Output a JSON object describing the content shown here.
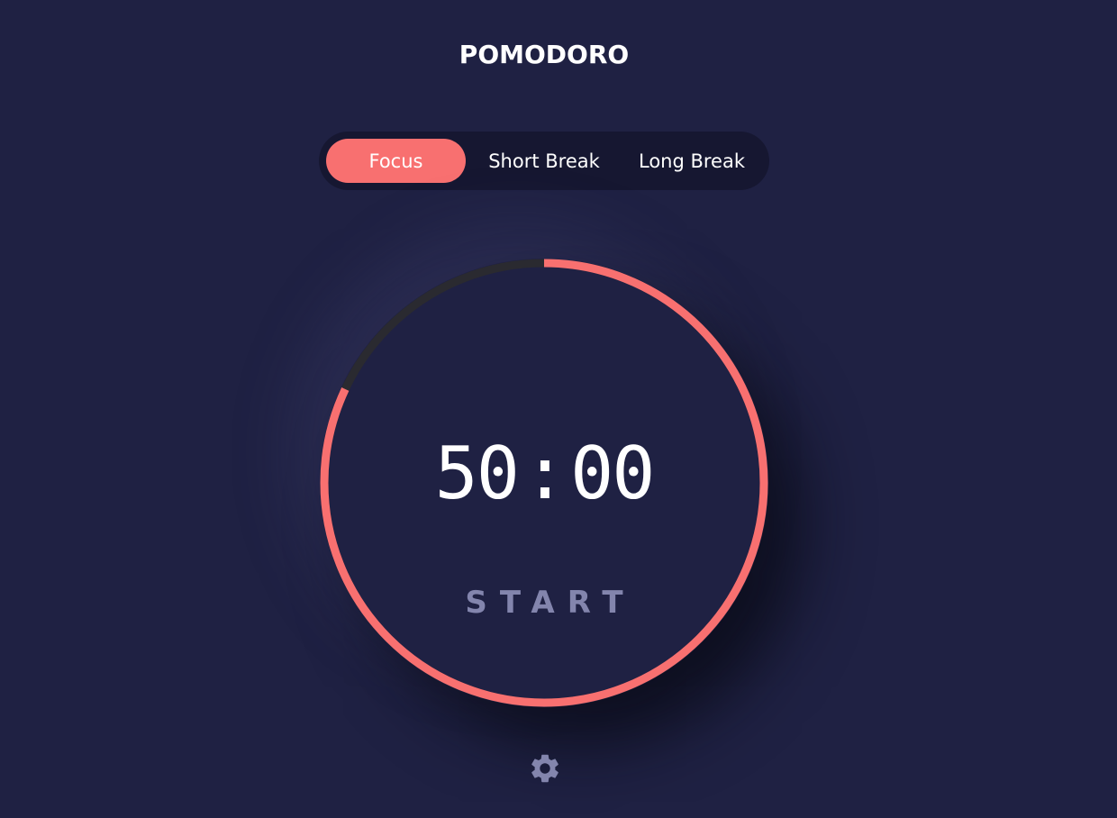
{
  "app": {
    "title": "POMODORO"
  },
  "modes": [
    {
      "label": "Focus",
      "active": true
    },
    {
      "label": "Short Break",
      "active": false
    },
    {
      "label": "Long Break",
      "active": false
    }
  ],
  "timer": {
    "minutes": "50",
    "separator": ":",
    "seconds": "00",
    "action_label": "START",
    "progress": 0.82
  },
  "icons": {
    "settings": "gear-icon"
  },
  "colors": {
    "background": "#1f2143",
    "accent": "#f87070",
    "track": "#2a2a30",
    "muted_text": "#8385ad"
  }
}
